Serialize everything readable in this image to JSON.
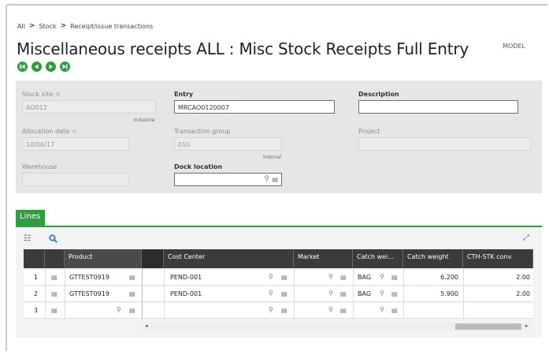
{
  "breadcrumb": {
    "item1": "All",
    "item2": "Stock",
    "item3": "Receipt/issue transactions"
  },
  "page_title": "Miscellaneous receipts ALL : Misc Stock Receipts Full Entry",
  "model_label": "MODEL",
  "form": {
    "stock_site": {
      "label": "Stock site",
      "value": "AO012",
      "hint": "Industrie"
    },
    "allocation_date": {
      "label": "Allocation date",
      "value": "10/06/17"
    },
    "warehouse": {
      "label": "Warehouse",
      "value": ""
    },
    "entry": {
      "label": "Entry",
      "value": "MRCAO0120007"
    },
    "transaction_group": {
      "label": "Transaction group",
      "value": "010",
      "hint": "Internal"
    },
    "dock_location": {
      "label": "Dock location",
      "value": ""
    },
    "description": {
      "label": "Description",
      "value": ""
    },
    "project": {
      "label": "Project",
      "value": ""
    }
  },
  "lines_tab": "Lines",
  "grid": {
    "headers": {
      "product": "Product",
      "cost_center": "Cost Center",
      "market": "Market",
      "catch_weight_unit": "Catch wei...",
      "catch_weight": "Catch weight",
      "cth_stk_conv": "CTH-STK conv."
    },
    "rows": [
      {
        "num": "1",
        "product": "GTTEST0919",
        "cost_center": "PEND-001",
        "catch_unit": "BAG",
        "catch_weight": "6.200",
        "conv": "2.00"
      },
      {
        "num": "2",
        "product": "GTTEST0919",
        "cost_center": "PEND-001",
        "catch_unit": "BAG",
        "catch_weight": "5.900",
        "conv": "2.00"
      },
      {
        "num": "3",
        "product": "",
        "cost_center": "",
        "catch_unit": "",
        "catch_weight": "",
        "conv": ""
      }
    ]
  },
  "icons": {
    "search": "search-icon",
    "list": "list-icon",
    "expand": "expand-icon",
    "nav": [
      "first-icon",
      "previous-icon",
      "next-icon",
      "last-icon"
    ]
  },
  "colors": {
    "accent_green": "#2e9e3e",
    "header_dark": "#3b3b3b",
    "link_blue": "#2a6fb8"
  }
}
